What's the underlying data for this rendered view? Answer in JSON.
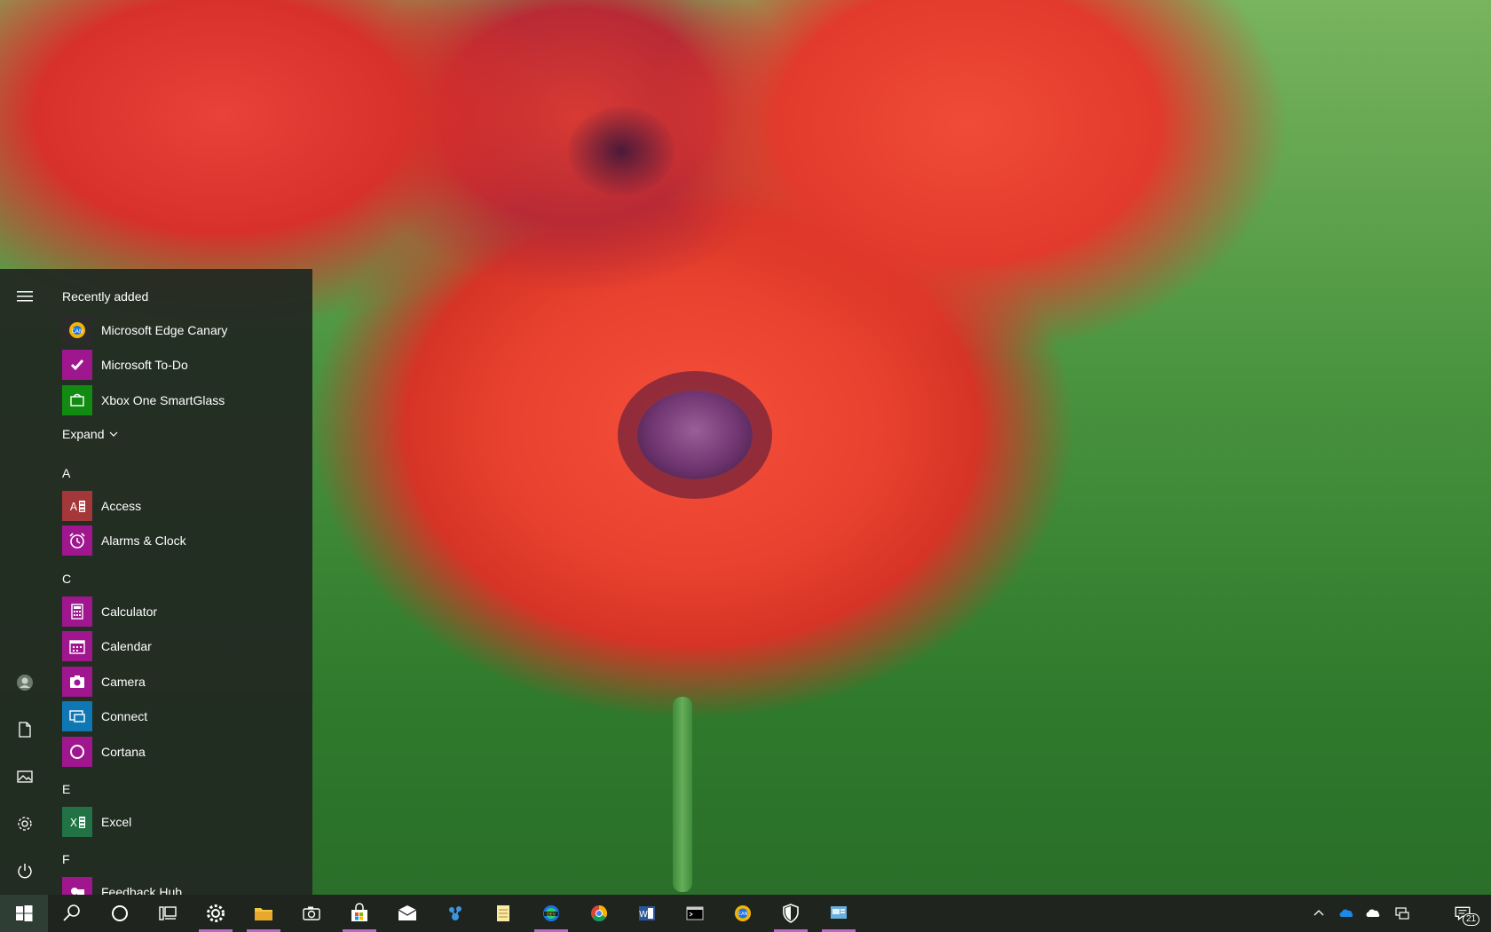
{
  "start_menu": {
    "recently_added_label": "Recently added",
    "recent_apps": [
      {
        "label": "Microsoft Edge Canary",
        "icon": "edge-canary-icon",
        "color": "#2b2b2b"
      },
      {
        "label": "Microsoft To-Do",
        "icon": "todo-check-icon",
        "color": "#a0168f"
      },
      {
        "label": "Xbox One SmartGlass",
        "icon": "xbox-smartglass-icon",
        "color": "#118b11"
      }
    ],
    "expand_label": "Expand",
    "groups": [
      {
        "letter": "A",
        "apps": [
          {
            "label": "Access",
            "icon": "access-icon",
            "color": "#a4373a"
          },
          {
            "label": "Alarms & Clock",
            "icon": "alarm-clock-icon",
            "color": "#a0168f"
          }
        ]
      },
      {
        "letter": "C",
        "apps": [
          {
            "label": "Calculator",
            "icon": "calculator-icon",
            "color": "#a0168f"
          },
          {
            "label": "Calendar",
            "icon": "calendar-icon",
            "color": "#a0168f"
          },
          {
            "label": "Camera",
            "icon": "camera-icon",
            "color": "#a0168f"
          },
          {
            "label": "Connect",
            "icon": "connect-icon",
            "color": "#0f78b4"
          },
          {
            "label": "Cortana",
            "icon": "cortana-icon",
            "color": "#a0168f"
          }
        ]
      },
      {
        "letter": "E",
        "apps": [
          {
            "label": "Excel",
            "icon": "excel-icon",
            "color": "#217346"
          }
        ]
      },
      {
        "letter": "F",
        "apps": [
          {
            "label": "Feedback Hub",
            "icon": "feedback-hub-icon",
            "color": "#a0168f"
          }
        ]
      }
    ],
    "rail": [
      "hamburger-menu-icon",
      "user-avatar-icon",
      "documents-icon",
      "pictures-icon",
      "settings-icon",
      "power-icon"
    ]
  },
  "taskbar": {
    "pinned": [
      "windows-start-icon",
      "search-icon",
      "cortana-circle-icon",
      "task-view-icon",
      "settings-gear-icon",
      "file-explorer-icon",
      "camera-app-icon",
      "store-icon",
      "mail-icon",
      "network-app-icon",
      "notepad-icon",
      "edge-dev-icon",
      "chrome-icon",
      "word-icon",
      "terminal-icon",
      "edge-canary-taskbar-icon",
      "security-shield-icon",
      "remote-desktop-icon"
    ],
    "notification_count": "21",
    "accent": "#b968c7"
  }
}
